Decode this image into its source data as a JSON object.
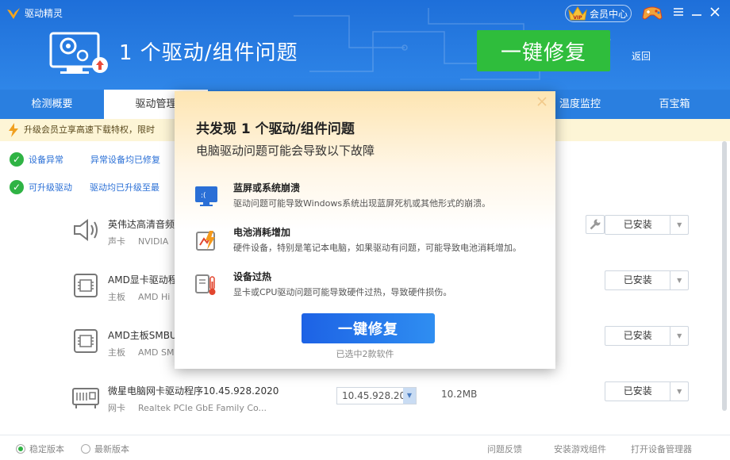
{
  "app": {
    "title": "驱动精灵"
  },
  "header": {
    "headline": "1 个驱动/组件问题",
    "fix_button": "一键修复",
    "back": "返回",
    "vip_label": "会员中心",
    "vip_badge": "VIP"
  },
  "tabs": [
    {
      "label": "检测概要",
      "active": false
    },
    {
      "label": "驱动管理",
      "active": true
    },
    {
      "label": "温度监控",
      "active": false
    },
    {
      "label": "百宝箱",
      "active": false
    }
  ],
  "notice": {
    "text": "升级会员立享高速下载特权，限时"
  },
  "status": [
    {
      "label": "设备异常",
      "desc": "异常设备均已修复"
    },
    {
      "label": "可升级驱动",
      "desc": "驱动均已升级至最"
    }
  ],
  "drivers": [
    {
      "name": "英伟达高清音频",
      "category": "声卡",
      "vendor": "NVIDIA",
      "icon": "speaker-icon",
      "action": "已安装"
    },
    {
      "name": "AMD显卡驱动程",
      "category": "主板",
      "vendor": "AMD Hi",
      "icon": "chip-icon",
      "action": "已安装"
    },
    {
      "name": "AMD主板SMBU",
      "category": "主板",
      "vendor": "AMD SM",
      "icon": "chip-icon",
      "action": "已安装"
    },
    {
      "name": "微星电脑网卡驱动程序10.45.928.2020",
      "category": "网卡",
      "vendor": "Realtek PCIe GbE Family Co...",
      "icon": "network-card-icon",
      "version": "10.45.928.20",
      "size": "10.2MB",
      "action": "已安装"
    }
  ],
  "footer": {
    "radio_stable": "稳定版本",
    "radio_latest": "最新版本",
    "stable_selected": true,
    "feedback": "问题反馈",
    "install_game": "安装游戏组件",
    "device_manager": "打开设备管理器"
  },
  "modal": {
    "title": "共发现 1 个驱动/组件问题",
    "subtitle": "电脑驱动问题可能会导致以下故障",
    "issues": [
      {
        "title": "蓝屏或系统崩溃",
        "desc": "驱动问题可能导致Windows系统出现蓝屏死机或其他形式的崩溃。",
        "icon": "bluescreen-icon"
      },
      {
        "title": "电池消耗增加",
        "desc": "硬件设备，特别是笔记本电脑，如果驱动有问题，可能导致电池消耗增加。",
        "icon": "battery-drain-icon"
      },
      {
        "title": "设备过热",
        "desc": "显卡或CPU驱动问题可能导致硬件过热，导致硬件损伤。",
        "icon": "overheat-icon"
      }
    ],
    "button": "一键修复",
    "note": "已选中2款软件"
  },
  "colors": {
    "header_blue": "#1e6fd9",
    "fix_green": "#2fbd3c",
    "check_green": "#2fb344",
    "modal_button": "#1d62e5"
  }
}
